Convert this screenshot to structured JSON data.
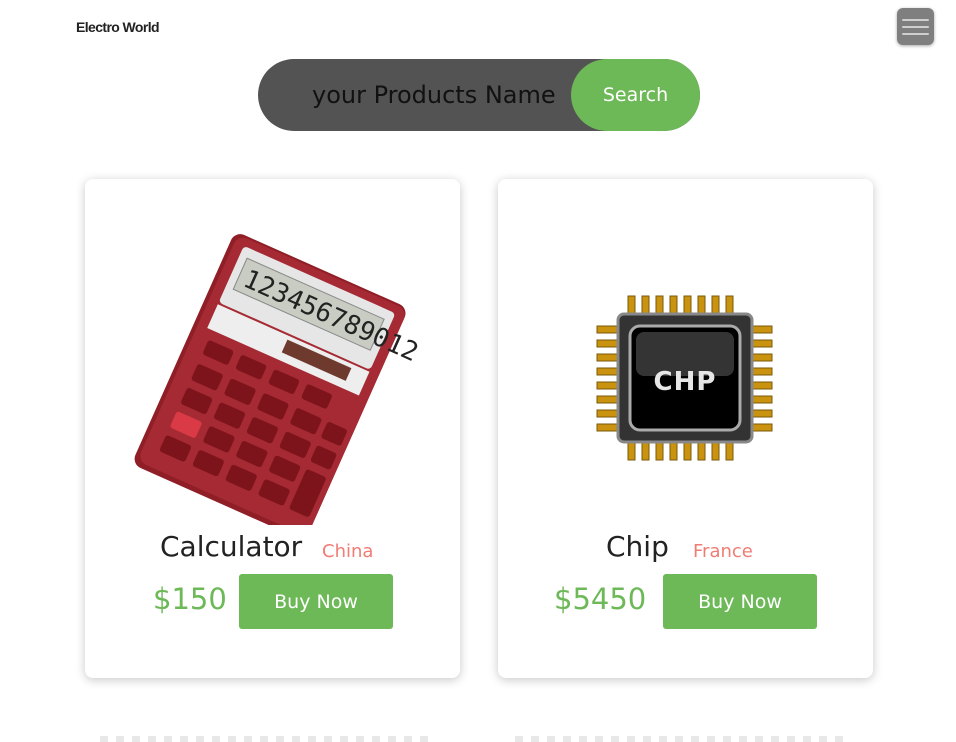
{
  "header": {
    "brand": "Electro World",
    "menu_icon": "hamburger-menu-icon"
  },
  "search": {
    "placeholder": "your Products Name",
    "button_label": "Search"
  },
  "colors": {
    "accent": "#6db857",
    "origin": "#f07c74",
    "search_bg": "#535353"
  },
  "products": [
    {
      "name": "Calculator",
      "origin": "China",
      "price": "$150",
      "button": "Buy Now",
      "image": "calculator-image"
    },
    {
      "name": "Chip",
      "origin": "France",
      "price": "$5450",
      "button": "Buy Now",
      "image": "chip-image"
    }
  ]
}
